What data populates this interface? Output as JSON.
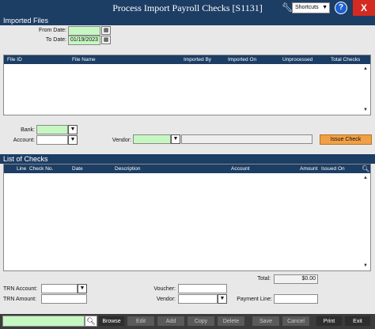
{
  "window": {
    "title": "Process Import Payroll Checks [S1131]",
    "shortcuts_label": "Shortcuts",
    "help_label": "?",
    "close_label": "X"
  },
  "imported_files": {
    "section_title": "Imported Files",
    "from_date_label": "From Date:",
    "from_date_value": "",
    "to_date_label": "To Date:",
    "to_date_value": "01/19/2023",
    "columns": [
      "File ID",
      "File Name",
      "Imported By",
      "Imported On",
      "Unprocessed",
      "Total Checks"
    ]
  },
  "filters": {
    "bank_label": "Bank:",
    "account_label": "Account:",
    "vendor_label": "Vendor:",
    "issue_check_label": "Issue Check"
  },
  "checks": {
    "section_title": "List of Checks",
    "columns": [
      "Line",
      "Check No.",
      "Date",
      "Description",
      "Account",
      "Amount",
      "Issued On"
    ],
    "total_label": "Total:",
    "total_value": "$0.00"
  },
  "footer_fields": {
    "trn_account_label": "TRN Account:",
    "trn_amount_label": "TRN Amount:",
    "voucher_label": "Voucher:",
    "vendor_label": "Vendor:",
    "payment_line_label": "Payment Line:"
  },
  "toolbar": {
    "browse": "Browse",
    "edit": "Edit",
    "add": "Add",
    "copy": "Copy",
    "delete": "Delete",
    "save": "Save",
    "cancel": "Cancel",
    "print": "Print",
    "exit": "Exit"
  },
  "colors": {
    "header_navy": "#1c3d64",
    "required_green": "#c6f7c2",
    "issue_orange": "#f0a046",
    "close_red": "#d42a1f"
  }
}
